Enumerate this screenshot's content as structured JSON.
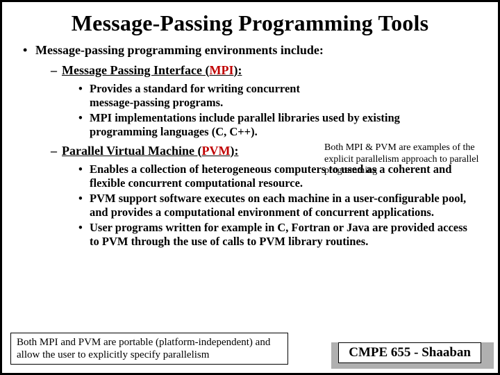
{
  "title": "Message-Passing Programming Tools",
  "intro": "Message-passing programming environments include:",
  "sections": [
    {
      "heading_plain": "Message Passing Interface (",
      "heading_acr": "MPI",
      "heading_tail": "):",
      "bullets": [
        "Provides a standard  for writing concurrent message-passing programs.",
        "MPI implementations include parallel libraries used by existing programming languages (C, C++)."
      ]
    },
    {
      "heading_plain": "Parallel Virtual Machine (",
      "heading_acr": "PVM",
      "heading_tail": "):",
      "bullets": [
        "Enables a collection of heterogeneous computers to used as a coherent and flexible concurrent computational resource.",
        "PVM support software executes on each machine in a user-configurable pool, and provides a computational environment of concurrent applications.",
        "User programs written for example in C, Fortran or Java are provided access to PVM through the use of calls to PVM library routines."
      ]
    }
  ],
  "aside": "Both MPI & PVM are examples of the explicit parallelism approach to parallel programming",
  "note": "Both MPI and PVM are portable (platform-independent) and allow the user to explicitly specify parallelism",
  "footer": "CMPE 655 - Shaaban"
}
